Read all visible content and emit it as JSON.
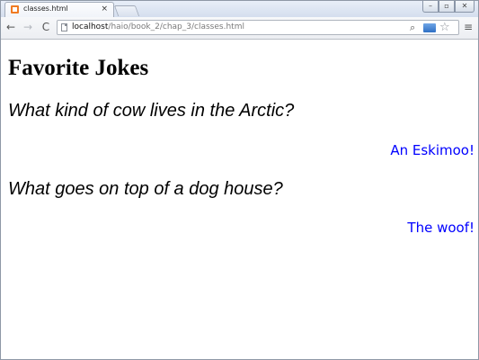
{
  "browser": {
    "tab": {
      "title": "classes.html",
      "close_glyph": "×",
      "favicon": "html-file-icon"
    },
    "window_controls": {
      "minimize": "–",
      "maximize": "▫",
      "close": "✕"
    },
    "toolbar": {
      "back": "←",
      "forward": "→",
      "reload": "C",
      "url_host": "localhost",
      "url_path": "/haio/book_2/chap_3/classes.html",
      "zoom": "⌕",
      "bookmark": "☆",
      "menu": "≡"
    }
  },
  "page": {
    "heading": "Favorite Jokes",
    "jokes": [
      {
        "question": "What kind of cow lives in the Arctic?",
        "answer": "An Eskimoo!"
      },
      {
        "question": "What goes on top of a dog house?",
        "answer": "The woof!"
      }
    ]
  },
  "colors": {
    "answer_text": "#0000ff",
    "favicon": "#f07b22"
  }
}
